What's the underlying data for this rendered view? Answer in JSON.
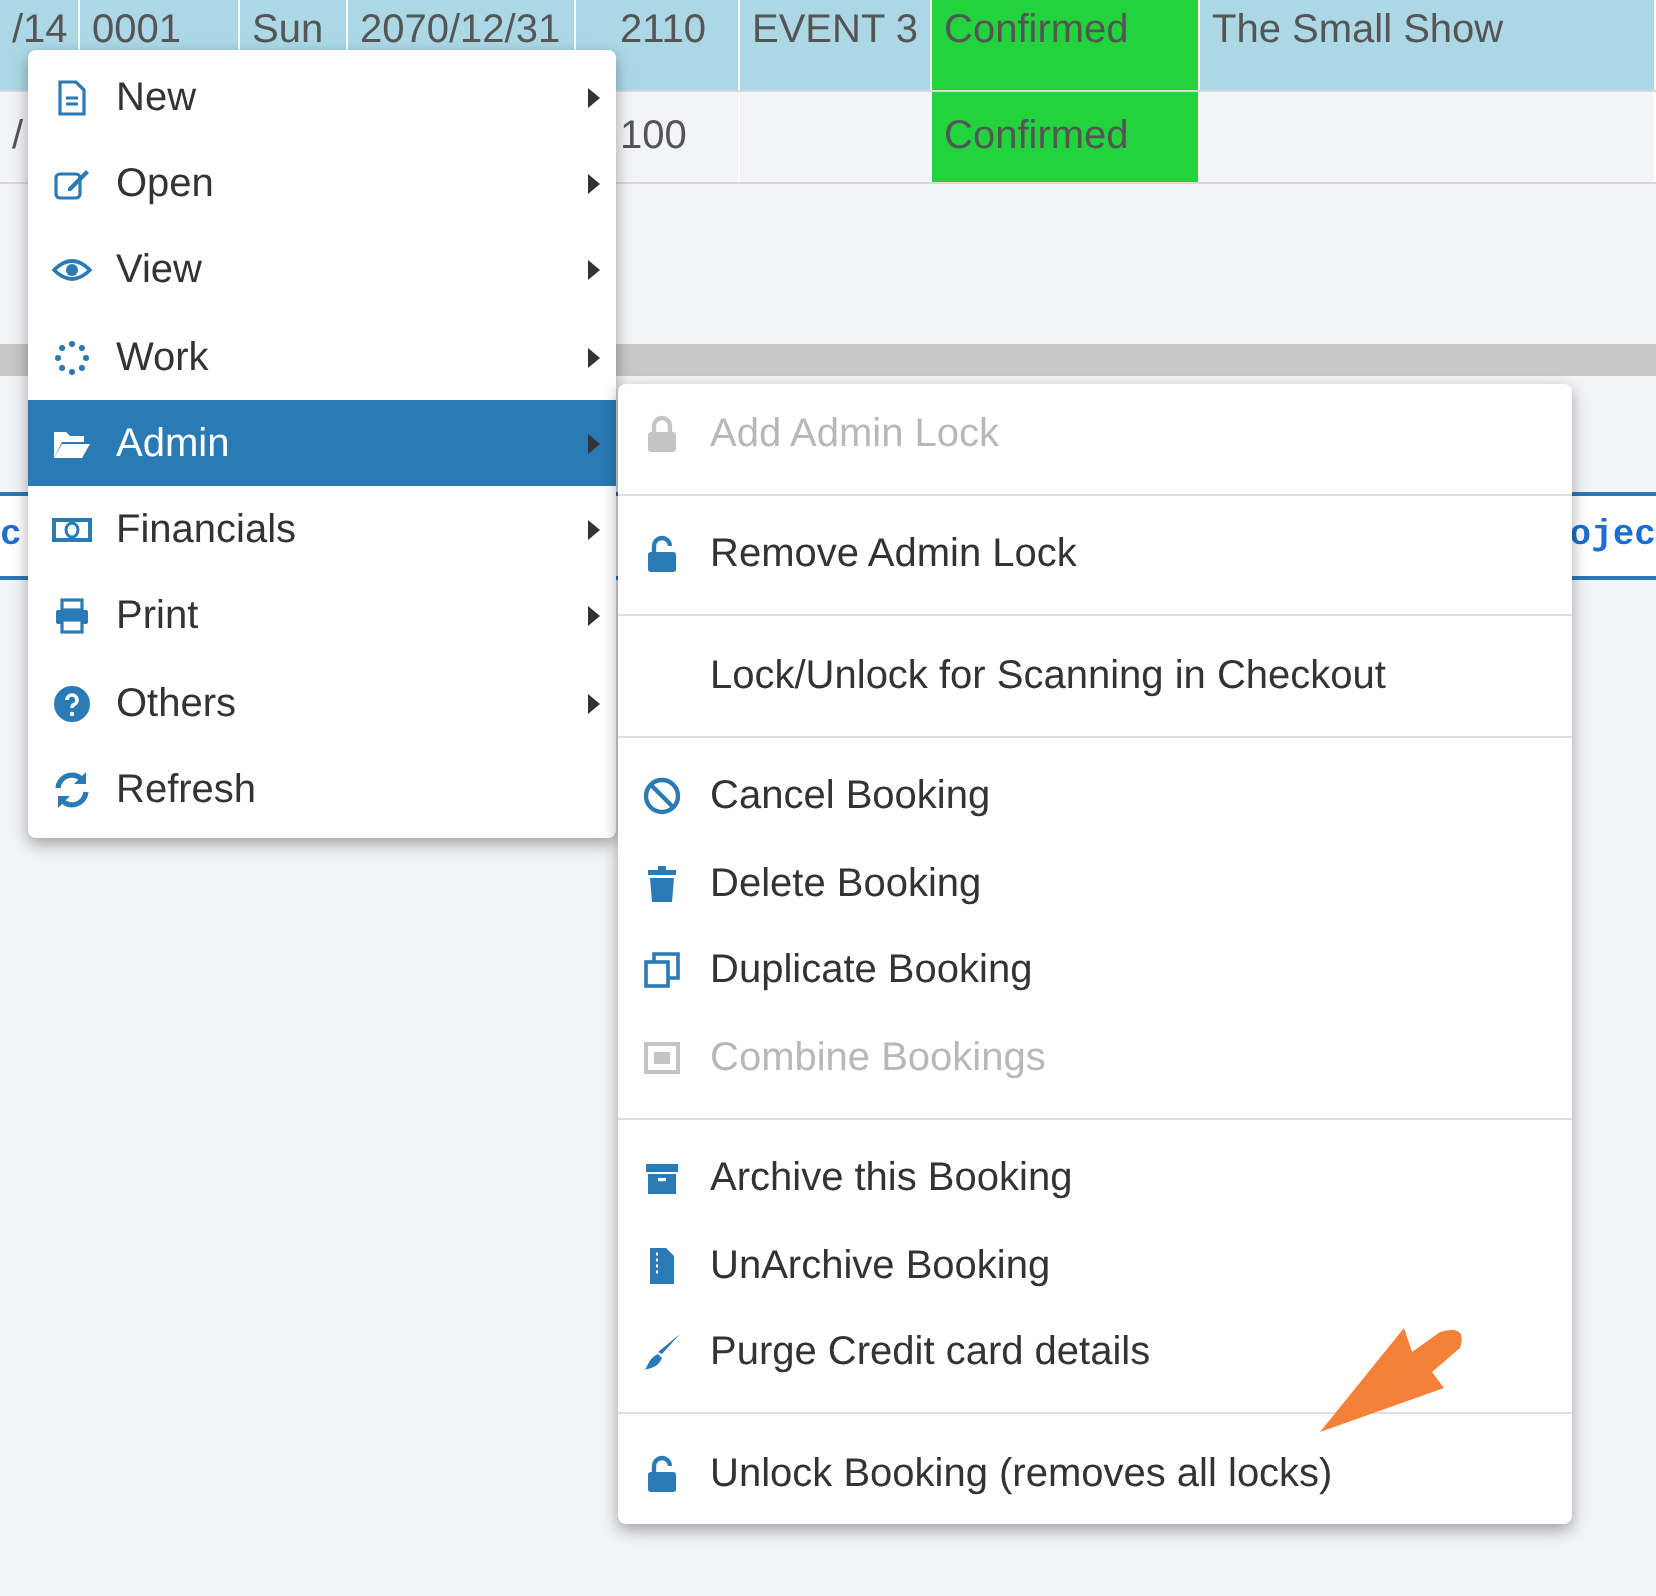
{
  "table": {
    "rows": [
      {
        "selected": true,
        "cells": [
          "/14",
          "0001",
          "Sun",
          "2070/12/31",
          "2110",
          "EVENT 3",
          "Confirmed",
          "The Small Show"
        ]
      },
      {
        "selected": false,
        "cells": [
          "/",
          "",
          "",
          "",
          "100",
          "",
          "Confirmed",
          ""
        ]
      }
    ]
  },
  "tab_bar": {
    "left_text": "c",
    "right_text": "ojec"
  },
  "context_menu": {
    "items": [
      {
        "label": "New",
        "selected": false,
        "submenu": true
      },
      {
        "label": "Open",
        "selected": false,
        "submenu": true
      },
      {
        "label": "View",
        "selected": false,
        "submenu": true
      },
      {
        "label": "Work",
        "selected": false,
        "submenu": true
      },
      {
        "label": "Admin",
        "selected": true,
        "submenu": true
      },
      {
        "label": "Financials",
        "selected": false,
        "submenu": true
      },
      {
        "label": "Print",
        "selected": false,
        "submenu": true
      },
      {
        "label": "Others",
        "selected": false,
        "submenu": true
      },
      {
        "label": "Refresh",
        "selected": false,
        "submenu": false
      }
    ]
  },
  "admin_submenu": {
    "groups": [
      [
        {
          "label": "Add Admin Lock",
          "disabled": true
        }
      ],
      [
        {
          "label": "Remove Admin Lock",
          "disabled": false
        }
      ],
      [
        {
          "label": "Lock/Unlock for Scanning in Checkout",
          "disabled": false
        }
      ],
      [
        {
          "label": "Cancel Booking",
          "disabled": false
        },
        {
          "label": "Delete Booking",
          "disabled": false
        },
        {
          "label": "Duplicate Booking",
          "disabled": false
        },
        {
          "label": "Combine Bookings",
          "disabled": true
        }
      ],
      [
        {
          "label": "Archive this Booking",
          "disabled": false
        },
        {
          "label": "UnArchive Booking",
          "disabled": false
        },
        {
          "label": "Purge Credit card details",
          "disabled": false
        }
      ],
      [
        {
          "label": "Unlock Booking (removes all locks)",
          "disabled": false
        }
      ]
    ]
  }
}
